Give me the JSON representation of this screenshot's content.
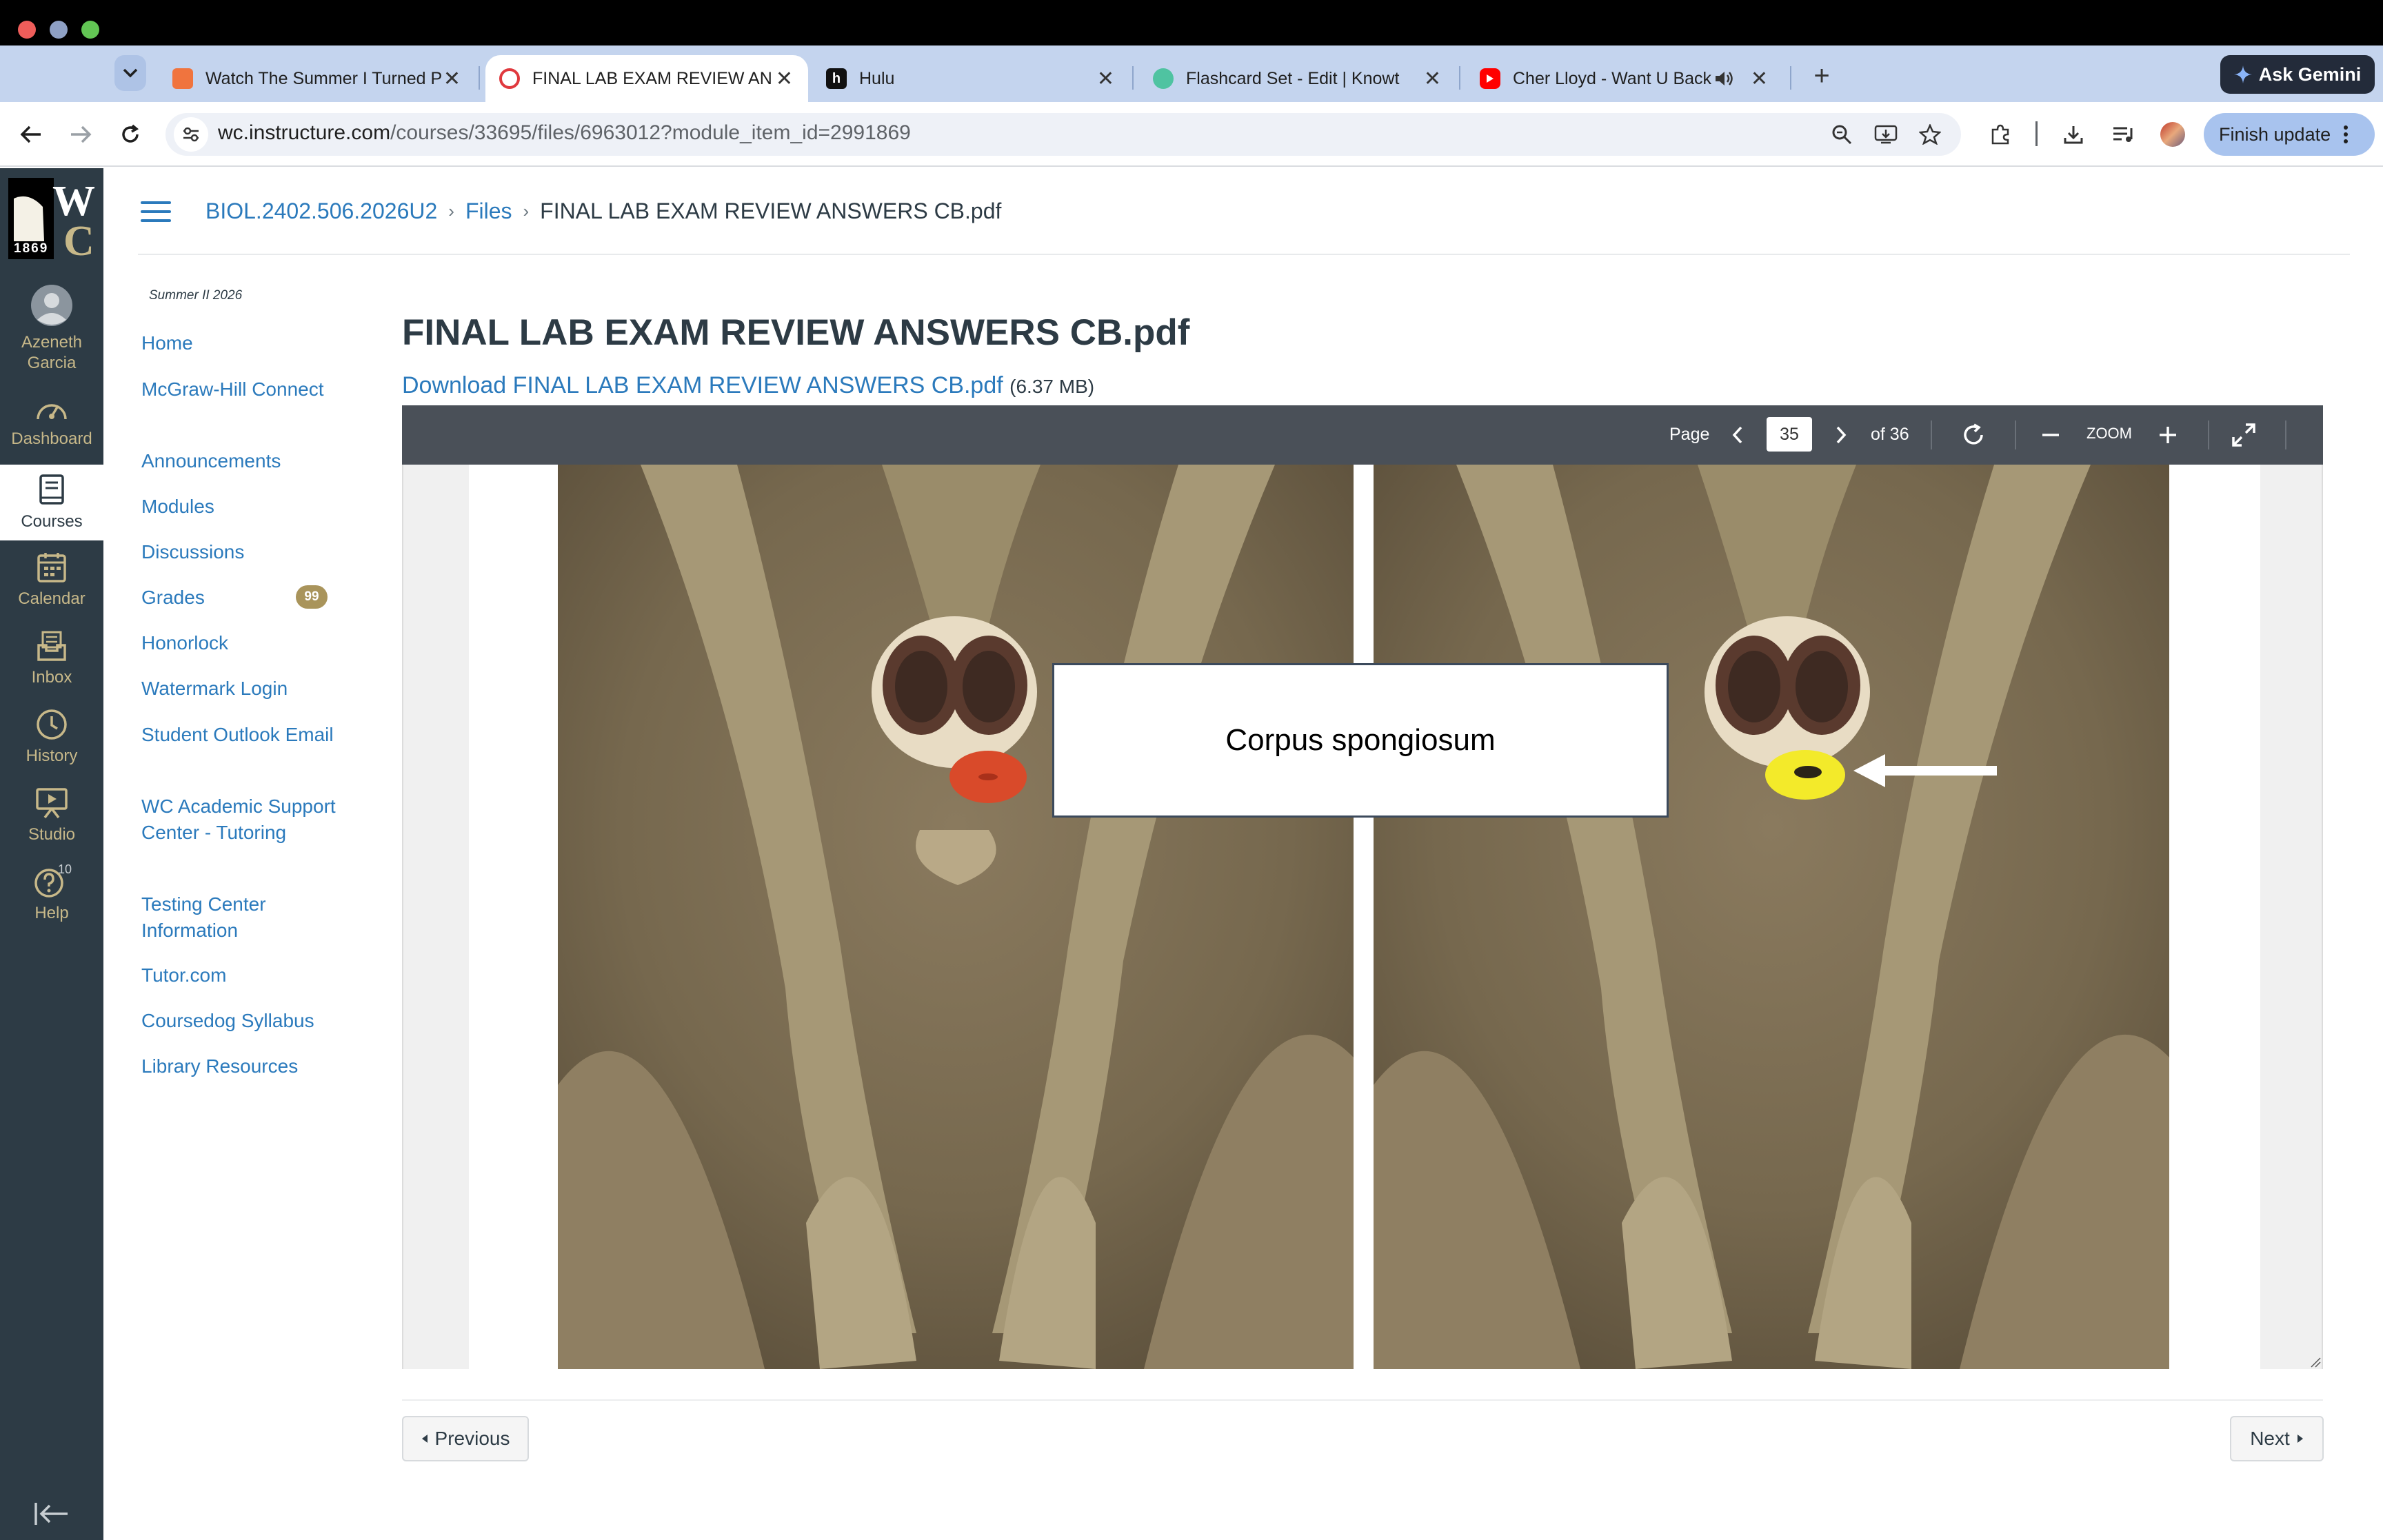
{
  "browser": {
    "tabs": [
      {
        "title": "Watch The Summer I Turned P",
        "favicon_color": "#f0743e"
      },
      {
        "title": "FINAL LAB EXAM REVIEW AN",
        "favicon_color": "#e0393e"
      },
      {
        "title": "Hulu",
        "favicon_letter": "h",
        "favicon_color": "#111111"
      },
      {
        "title": "Flashcard Set - Edit | Knowt",
        "favicon_color": "#4fc3a1"
      },
      {
        "title": "Cher Lloyd - Want U Back",
        "favicon_color": "#ff0000"
      }
    ],
    "ask_gemini": "Ask Gemini",
    "url_host": "wc.instructure.com",
    "url_path": "/courses/33695/files/6963012?module_item_id=2991869",
    "finish_update": "Finish update"
  },
  "global_nav": {
    "logo_text": "WC",
    "logo_year": "1869",
    "items": [
      {
        "label": "Azeneth Garcia",
        "icon": "avatar-icon"
      },
      {
        "label": "Dashboard",
        "icon": "dashboard-icon"
      },
      {
        "label": "Courses",
        "icon": "courses-icon",
        "active": true
      },
      {
        "label": "Calendar",
        "icon": "calendar-icon"
      },
      {
        "label": "Inbox",
        "icon": "inbox-icon"
      },
      {
        "label": "History",
        "icon": "history-icon"
      },
      {
        "label": "Studio",
        "icon": "studio-icon"
      },
      {
        "label": "Help",
        "icon": "help-icon",
        "badge": "10"
      }
    ]
  },
  "breadcrumb": {
    "course": "BIOL.2402.506.2026U2",
    "files": "Files",
    "current": "FINAL LAB EXAM REVIEW ANSWERS CB.pdf"
  },
  "course_nav": {
    "term": "Summer II 2026",
    "items": [
      {
        "label": "Home"
      },
      {
        "label": "McGraw-Hill Connect"
      },
      {
        "label": "Announcements"
      },
      {
        "label": "Modules"
      },
      {
        "label": "Discussions"
      },
      {
        "label": "Grades",
        "badge": "99"
      },
      {
        "label": "Honorlock"
      },
      {
        "label": "Watermark Login"
      },
      {
        "label": "Student Outlook Email"
      },
      {
        "label": "WC Academic Support Center - Tutoring"
      },
      {
        "label": "Testing Center Information"
      },
      {
        "label": "Tutor.com"
      },
      {
        "label": "Coursedog Syllabus"
      },
      {
        "label": "Library Resources"
      }
    ]
  },
  "file": {
    "title": "FINAL LAB EXAM REVIEW ANSWERS CB.pdf",
    "download_label": "Download FINAL LAB EXAM REVIEW ANSWERS CB.pdf",
    "size": "(6.37 MB)"
  },
  "viewer": {
    "page_label": "Page",
    "current_page": "35",
    "total_label": "of 36",
    "zoom_label": "ZOOM",
    "callout_text": "Corpus spongiosum"
  },
  "pager": {
    "previous": "Previous",
    "next": "Next"
  },
  "colors": {
    "canvas_nav": "#2d3b45",
    "link": "#2b7abc",
    "badge": "#a9945b",
    "highlight_red": "#d94a2a",
    "highlight_yellow": "#f3ea2a"
  }
}
